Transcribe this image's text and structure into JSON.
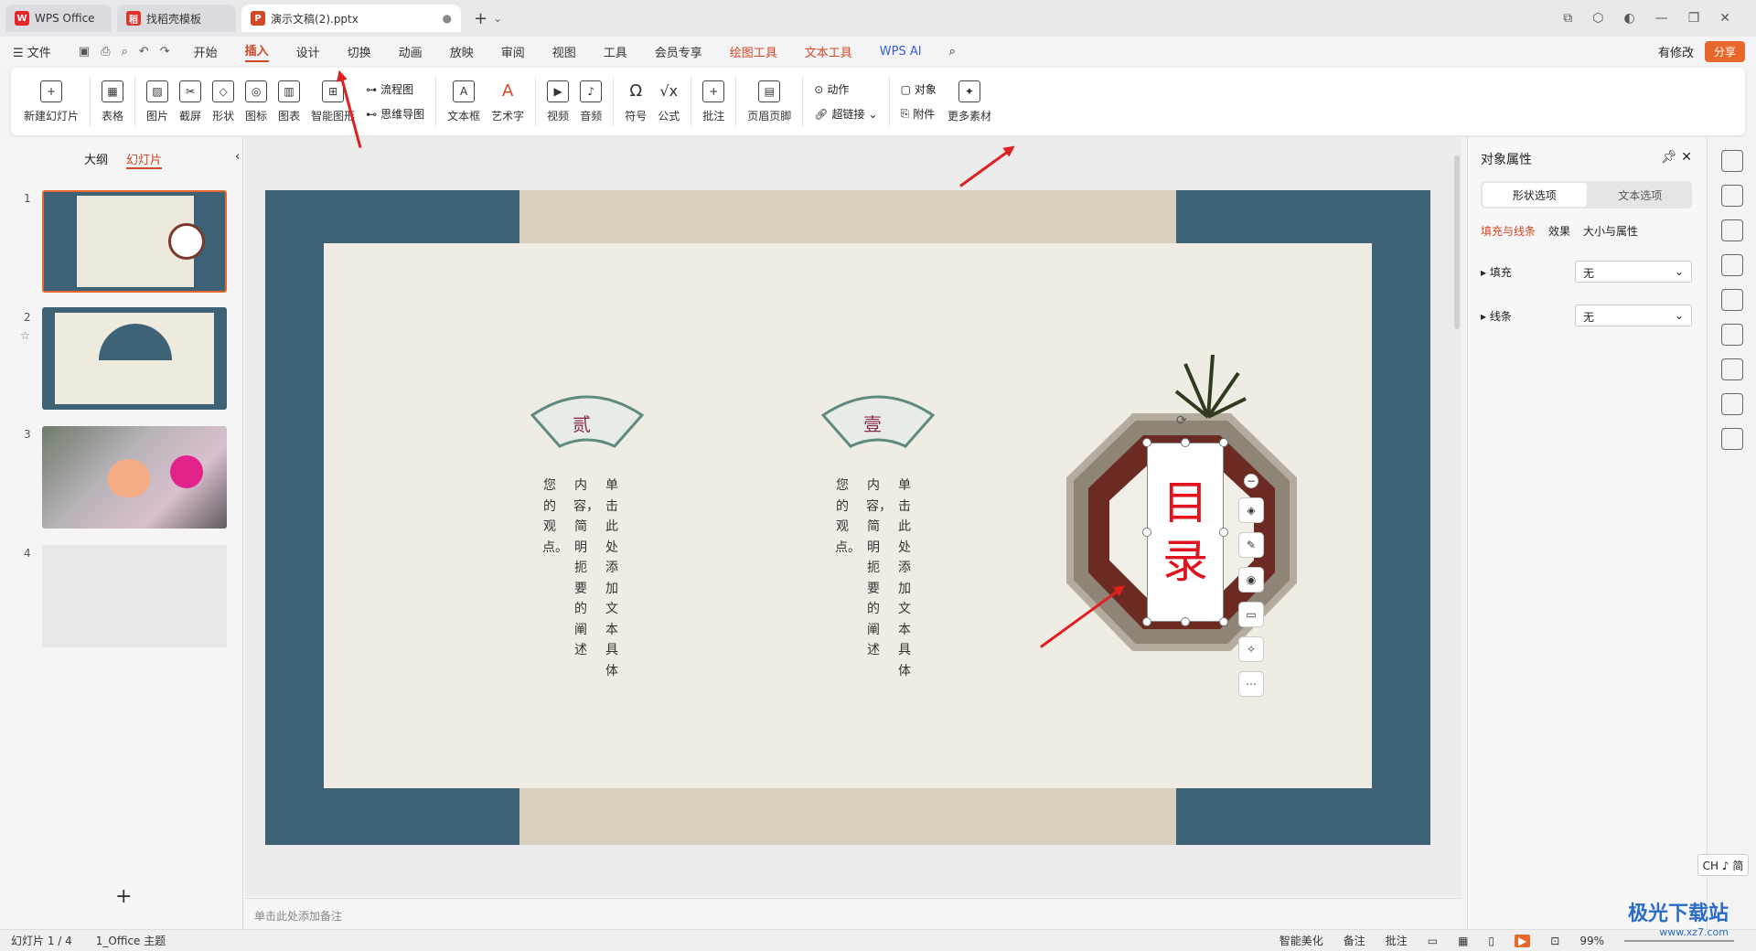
{
  "tabs": [
    {
      "label": "WPS Office",
      "badge": "W"
    },
    {
      "label": "找稻壳模板",
      "badge": "稻"
    },
    {
      "label": "演示文稿(2).pptx",
      "badge": "P"
    }
  ],
  "menu": {
    "file": "文件",
    "items": [
      "开始",
      "插入",
      "设计",
      "切换",
      "动画",
      "放映",
      "审阅",
      "视图",
      "工具",
      "会员专享"
    ],
    "active": "插入",
    "context_tabs": [
      "绘图工具",
      "文本工具"
    ],
    "wps_ai": "WPS AI",
    "modified": "有修改",
    "share": "分享"
  },
  "ribbon": {
    "new_slide": "新建幻灯片",
    "table": "表格",
    "picture": "图片",
    "screenshot": "截屏",
    "shape": "形状",
    "icon": "图标",
    "chart": "图表",
    "smart_graphic": "智能图形",
    "flowchart": "流程图",
    "mindmap": "思维导图",
    "textbox": "文本框",
    "wordart": "艺术字",
    "video": "视频",
    "audio": "音频",
    "symbol": "符号",
    "formula": "公式",
    "comment": "批注",
    "header_footer": "页眉页脚",
    "action": "动作",
    "hyperlink": "超链接",
    "object": "对象",
    "attachment": "附件",
    "more": "更多素材"
  },
  "left_panel": {
    "tab_outline": "大纲",
    "tab_slides": "幻灯片",
    "slide_numbers": [
      "1",
      "2",
      "3",
      "4"
    ],
    "add": "+"
  },
  "slide": {
    "fan_left": "贰",
    "fan_right": "壹",
    "col_text_1": "单击此处添加文本具体",
    "col_text_2": "内容，简明扼要的阐述",
    "col_text_3": "您的观点。",
    "toc_line1": "目",
    "toc_line2": "录"
  },
  "notes_placeholder": "单击此处添加备注",
  "right_panel": {
    "title": "对象属性",
    "seg_shape": "形状选项",
    "seg_text": "文本选项",
    "sub_fill_line": "填充与线条",
    "sub_effect": "效果",
    "sub_size": "大小与属性",
    "fill_label": "填充",
    "fill_value": "无",
    "line_label": "线条",
    "line_value": "无"
  },
  "status": {
    "slide_counter": "幻灯片 1 / 4",
    "theme": "1_Office 主题",
    "smart_beautify": "智能美化",
    "notes": "备注",
    "comment": "批注",
    "zoom": "99%"
  },
  "ime": "CH ♪ 简",
  "watermark": {
    "title": "极光下载站",
    "url": "www.xz7.com"
  },
  "colors": {
    "accent": "#d24726",
    "slide_frame": "#3e6275",
    "toc_red": "#e0141e"
  }
}
